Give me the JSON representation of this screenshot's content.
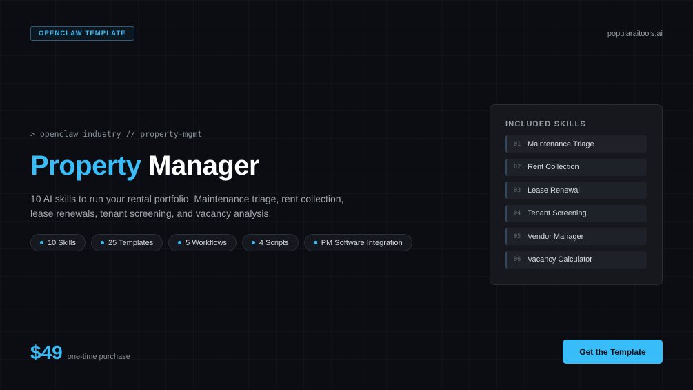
{
  "header": {
    "badge": "OPENCLAW TEMPLATE",
    "domain": "popularaitools.ai"
  },
  "hero": {
    "command": "> openclaw industry // property-mgmt",
    "title_accent": "Property",
    "title_rest": "Manager",
    "description": "10 AI skills to run your rental portfolio. Maintenance triage, rent collection, lease renewals, tenant screening, and vacancy analysis."
  },
  "pills": [
    {
      "label": "10 Skills"
    },
    {
      "label": "25 Templates"
    },
    {
      "label": "5 Workflows"
    },
    {
      "label": "4 Scripts"
    },
    {
      "label": "PM Software Integration"
    }
  ],
  "skills_panel": {
    "title": "INCLUDED SKILLS",
    "items": [
      {
        "num": "01",
        "label": "Maintenance Triage"
      },
      {
        "num": "02",
        "label": "Rent Collection"
      },
      {
        "num": "03",
        "label": "Lease Renewal"
      },
      {
        "num": "04",
        "label": "Tenant Screening"
      },
      {
        "num": "05",
        "label": "Vendor Manager"
      },
      {
        "num": "06",
        "label": "Vacancy Calculator"
      }
    ]
  },
  "pricing": {
    "amount": "$49",
    "note": "one-time purchase"
  },
  "cta": {
    "label": "Get the Template"
  },
  "colors": {
    "accent": "#38bdf8",
    "background": "#0b0d12",
    "panel": "#16181d"
  }
}
